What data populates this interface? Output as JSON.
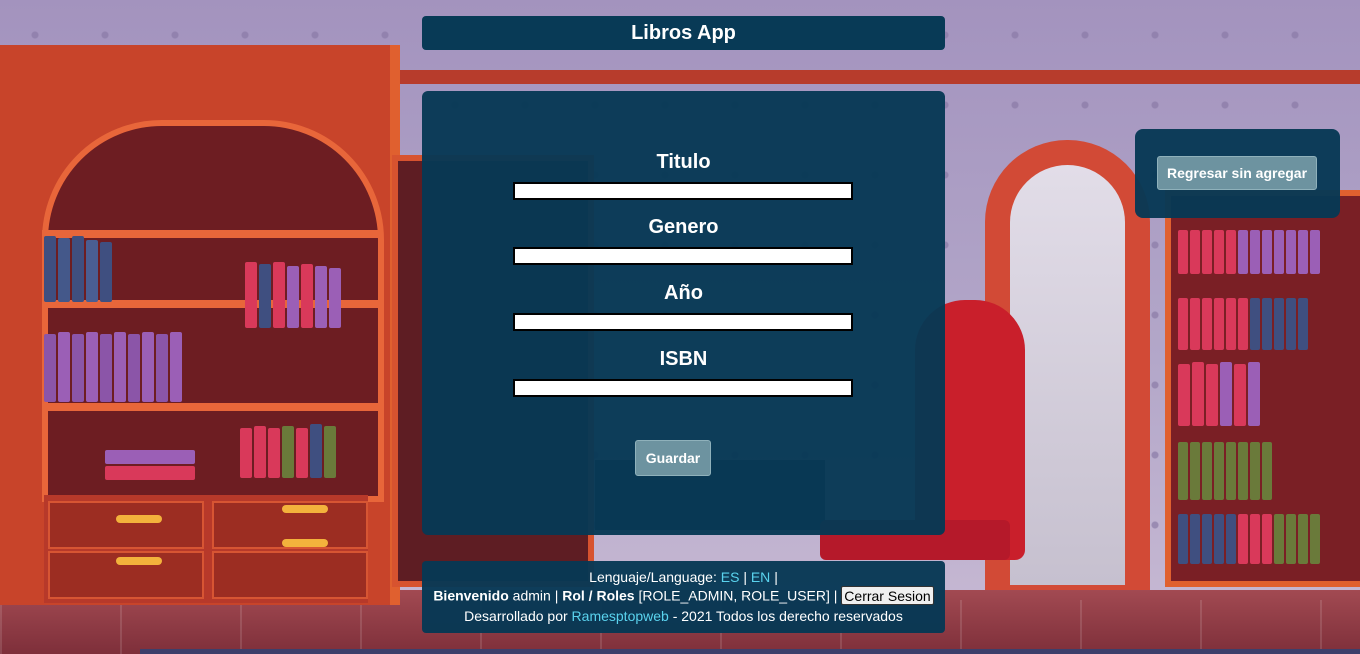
{
  "app": {
    "title": "Libros App"
  },
  "form": {
    "fields": [
      {
        "label": "Titulo",
        "value": ""
      },
      {
        "label": "Genero",
        "value": ""
      },
      {
        "label": "Año",
        "value": ""
      },
      {
        "label": "ISBN",
        "value": ""
      }
    ],
    "save_label": "Guardar"
  },
  "side": {
    "back_label": "Regresar sin agregar"
  },
  "footer": {
    "language_prefix": "Lenguaje/Language:",
    "lang_es": "ES",
    "lang_en": "EN",
    "sep1": "|",
    "sep2": "|",
    "welcome_label": "Bienvenido",
    "username": "admin",
    "sep3": "|",
    "roles_label": "Rol / Roles",
    "roles_value": "[ROLE_ADMIN, ROLE_USER]",
    "sep4": "|",
    "logout_label": "Cerrar Sesion",
    "dev_prefix": "Desarrollado por",
    "dev_link": "Ramesptopweb",
    "dev_suffix": "- 2021 Todos los derecho reservados"
  },
  "colors": {
    "panel": "#063854",
    "button": "#6d93a0",
    "link": "#5ad3ee"
  }
}
